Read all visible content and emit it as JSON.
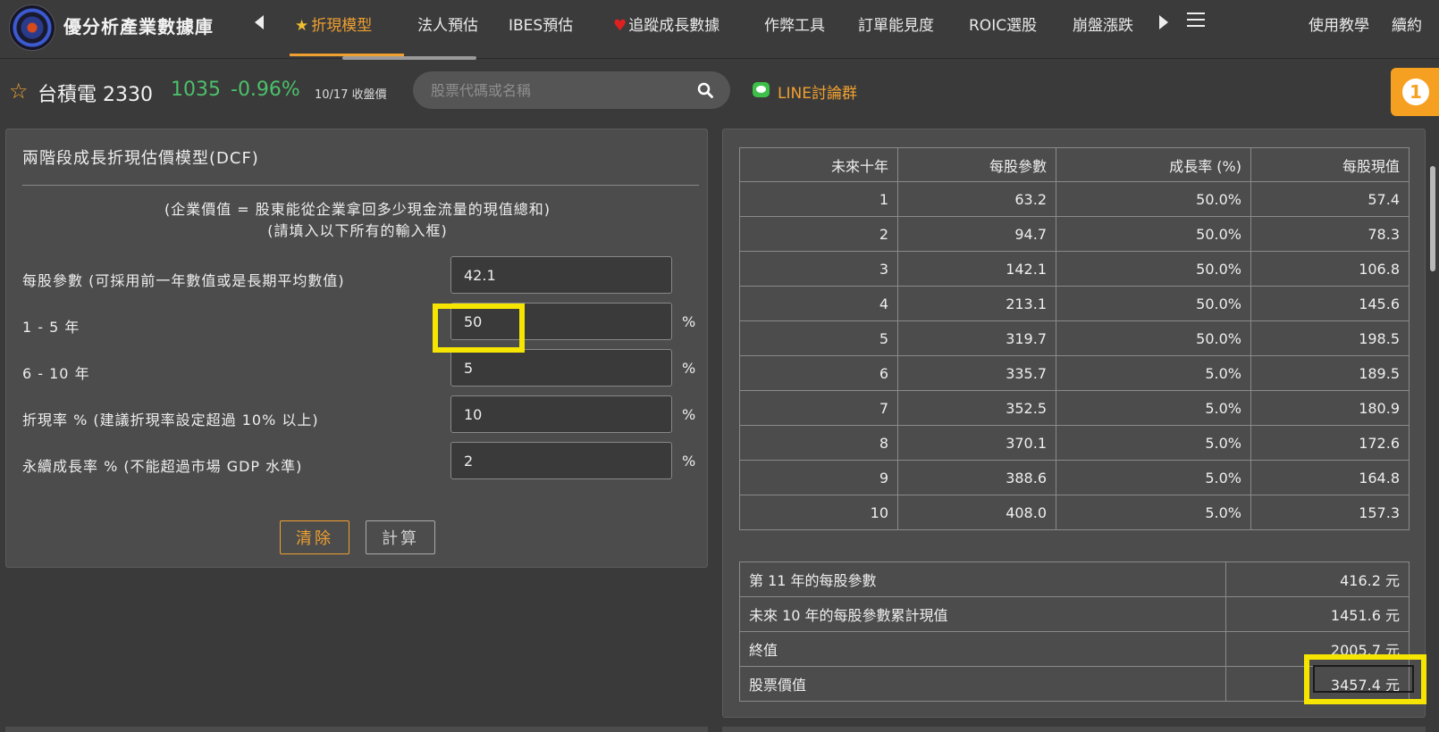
{
  "brand": "優分析產業數據庫",
  "nav": {
    "items": [
      "折現模型",
      "法人預估",
      "IBES預估",
      "追蹤成長數據",
      "作弊工具",
      "訂單能見度",
      "ROIC選股",
      "崩盤漲跌"
    ],
    "right": [
      "使用教學",
      "續約"
    ]
  },
  "stock": {
    "name": "台積電 2330",
    "price": "1035",
    "change": "-0.96%",
    "date": "10/17 收盤價",
    "search_placeholder": "股票代碼或名稱",
    "line_label": "LINE討論群",
    "badge": "1"
  },
  "dcf": {
    "title": "兩階段成長折現估價模型(DCF)",
    "subtitle1": "(企業價值 = 股東能從企業拿回多少現金流量的現值總和)",
    "subtitle2": "(請填入以下所有的輸入框)",
    "rows": [
      {
        "label": "每股參數 (可採用前一年數值或是長期平均數值)",
        "value": "42.1",
        "unit": ""
      },
      {
        "label": "1 - 5 年",
        "value": "50",
        "unit": "%"
      },
      {
        "label": "6 - 10 年",
        "value": "5",
        "unit": "%"
      },
      {
        "label": "折現率 % (建議折現率設定超過 10% 以上)",
        "value": "10",
        "unit": "%"
      },
      {
        "label": "永續成長率 % (不能超過市場 GDP 水準)",
        "value": "2",
        "unit": "%"
      }
    ],
    "clear_label": "清除",
    "calc_label": "計算"
  },
  "projection": {
    "headers": [
      "未來十年",
      "每股參數",
      "成長率 (%)",
      "每股現值"
    ],
    "rows": [
      [
        "1",
        "63.2",
        "50.0%",
        "57.4"
      ],
      [
        "2",
        "94.7",
        "50.0%",
        "78.3"
      ],
      [
        "3",
        "142.1",
        "50.0%",
        "106.8"
      ],
      [
        "4",
        "213.1",
        "50.0%",
        "145.6"
      ],
      [
        "5",
        "319.7",
        "50.0%",
        "198.5"
      ],
      [
        "6",
        "335.7",
        "5.0%",
        "189.5"
      ],
      [
        "7",
        "352.5",
        "5.0%",
        "180.9"
      ],
      [
        "8",
        "370.1",
        "5.0%",
        "172.6"
      ],
      [
        "9",
        "388.6",
        "5.0%",
        "164.8"
      ],
      [
        "10",
        "408.0",
        "5.0%",
        "157.3"
      ]
    ]
  },
  "summary": [
    {
      "label": "第 11 年的每股參數",
      "value": "416.2 元"
    },
    {
      "label": "未來 10 年的每股參數累計現值",
      "value": "1451.6 元"
    },
    {
      "label": "終值",
      "value": "2005.7 元"
    },
    {
      "label": "股票價值",
      "value": "3457.4 元"
    }
  ]
}
